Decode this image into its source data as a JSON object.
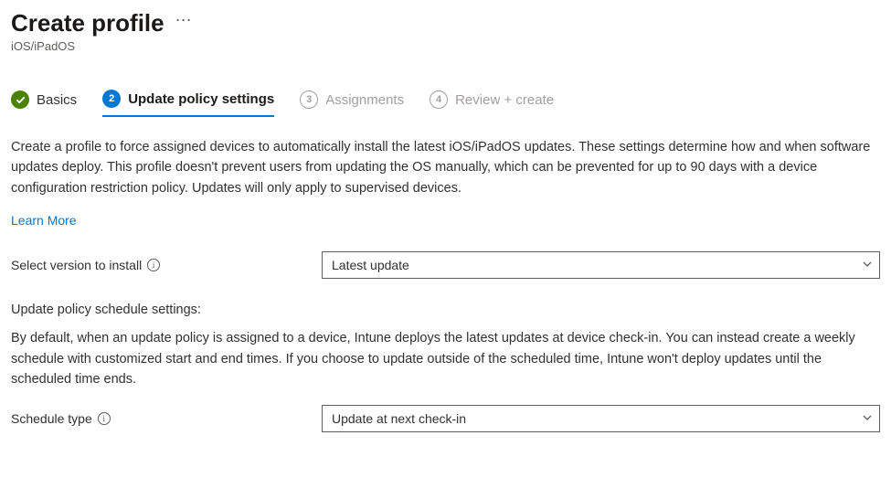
{
  "header": {
    "title": "Create profile",
    "subtitle": "iOS/iPadOS"
  },
  "tabs": {
    "items": [
      {
        "label": "Basics"
      },
      {
        "label": "Update policy settings"
      },
      {
        "label": "Assignments",
        "num": "3"
      },
      {
        "label": "Review + create",
        "num": "4"
      }
    ]
  },
  "main": {
    "description": "Create a profile to force assigned devices to automatically install the latest iOS/iPadOS updates. These settings determine how and when software updates deploy. This profile doesn't prevent users from updating the OS manually, which can be prevented for up to 90 days with a device configuration restriction policy. Updates will only apply to supervised devices.",
    "learn_more": "Learn More",
    "version_label": "Select version to install",
    "version_value": "Latest update",
    "schedule_section_label": "Update policy schedule settings:",
    "schedule_description": "By default, when an update policy is assigned to a device, Intune deploys the latest updates at device check-in. You can instead create a weekly schedule with customized start and end times. If you choose to update outside of the scheduled time, Intune won't deploy updates until the scheduled time ends.",
    "schedule_type_label": "Schedule type",
    "schedule_type_value": "Update at next check-in"
  }
}
